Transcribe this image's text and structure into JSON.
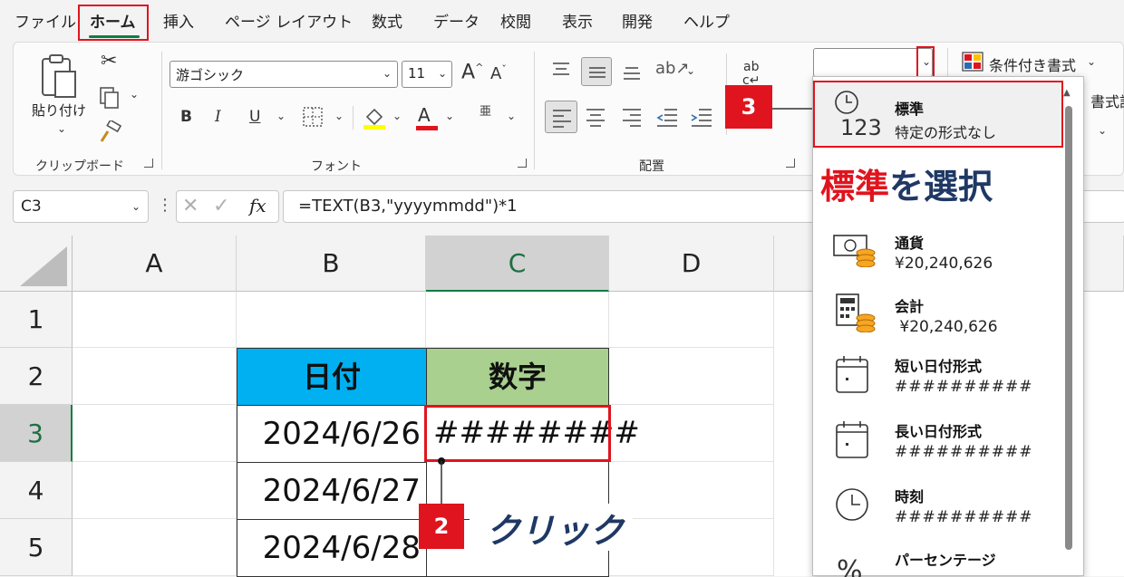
{
  "tabs": [
    "ファイル",
    "ホーム",
    "挿入",
    "ページ レイアウト",
    "数式",
    "データ",
    "校閲",
    "表示",
    "開発",
    "ヘルプ"
  ],
  "clipboard": {
    "paste_label": "貼り付け",
    "group_label": "クリップボード"
  },
  "font": {
    "name": "游ゴシック",
    "size": "11",
    "group_label": "フォント",
    "bold": "B",
    "italic": "I",
    "underline": "U",
    "font_color_glyph": "A",
    "phonetic_glyph": "亜"
  },
  "alignment": {
    "group_label": "配置"
  },
  "number": {
    "format_value": "",
    "conditional_label": "条件付き書式",
    "table_format_partial": "書式設"
  },
  "formula_bar": {
    "name_box": "C3",
    "fx": "fx",
    "formula": "=TEXT(B3,\"yyyymmdd\")*1"
  },
  "grid": {
    "columns": [
      "A",
      "B",
      "C",
      "D"
    ],
    "rows": [
      "1",
      "2",
      "3",
      "4",
      "5"
    ],
    "header_date": "日付",
    "header_number": "数字",
    "dates": [
      "2024/6/26",
      "2024/6/27",
      "2024/6/28"
    ],
    "c3_value": "########"
  },
  "format_menu": {
    "items": [
      {
        "title": "標準",
        "sub": "特定の形式なし",
        "icon": "clock-123-icon"
      },
      {
        "title": "通貨",
        "sub": "¥20,240,626",
        "icon": "currency-icon"
      },
      {
        "title": "会計",
        "sub": " ¥20,240,626",
        "icon": "accounting-icon"
      },
      {
        "title": "短い日付形式",
        "sub": "##########",
        "icon": "calendar-icon"
      },
      {
        "title": "長い日付形式",
        "sub": "##########",
        "icon": "calendar-icon"
      },
      {
        "title": "時刻",
        "sub": "##########",
        "icon": "clock-icon"
      },
      {
        "title": "パーセンテージ",
        "sub": "",
        "icon": "percent-icon"
      }
    ],
    "icon_123": "123"
  },
  "annotations": {
    "step2_number": "2",
    "step2_text": "クリック",
    "step3_number": "3",
    "select_red": "標準",
    "select_blue": "を選択"
  },
  "colors": {
    "header_date_bg": "#00b0f0",
    "header_number_bg": "#a9d08e",
    "accent_red": "#e0141e",
    "excel_green": "#107c41",
    "annotation_blue": "#1f3864"
  }
}
